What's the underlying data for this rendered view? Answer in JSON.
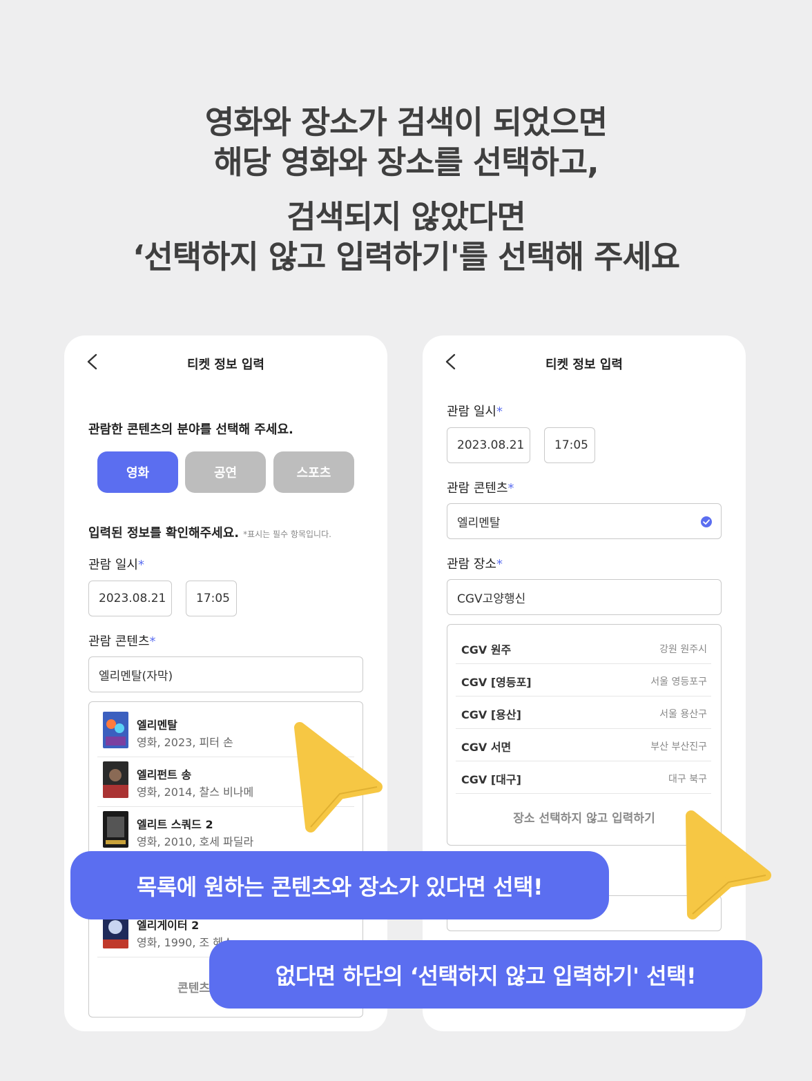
{
  "headline": {
    "line1": "영화와 장소가 검색이 되었으면",
    "line2": "해당 영화와 장소를 선택하고,",
    "line3": "검색되지 않았다면",
    "line4": "‘선택하지 않고 입력하기'를 선택해 주세요"
  },
  "left_screen": {
    "nav_title": "티켓 정보 입력",
    "category_prompt": "관람한 콘텐츠의 분야를 선택해 주세요.",
    "categories": [
      "영화",
      "공연",
      "스포츠"
    ],
    "selected_category": "영화",
    "confirm_title": "입력된 정보를 확인해주세요.",
    "confirm_hint": "*표시는 필수 항목입니다.",
    "date_label": "관람 일시",
    "required_mark": "*",
    "date_value": "2023.08.21",
    "time_value": "17:05",
    "content_label": "관람 콘텐츠",
    "content_value": "엘리멘탈(자막)",
    "movies": [
      {
        "title": "엘리멘탈",
        "sub": "영화, 2023, 피터 손"
      },
      {
        "title": "엘리펀트 송",
        "sub": "영화, 2014, 찰스 비나메"
      },
      {
        "title": "엘리트 스쿼드 2",
        "sub": "영화, 2010, 호세 파딜라"
      },
      {
        "title": "엘리게이터 2",
        "sub": "영화, 1990, 조 헤스"
      }
    ],
    "skip_label": "콘텐츠 선택하"
  },
  "right_screen": {
    "nav_title": "티켓 정보 입력",
    "date_label": "관람 일시",
    "required_mark": "*",
    "date_value": "2023.08.21",
    "time_value": "17:05",
    "content_label": "관람 콘텐츠",
    "content_value": "엘리멘탈",
    "place_label": "관람 장소",
    "place_value": "CGV고양행신",
    "places": [
      {
        "name": "CGV 원주",
        "region": "강원 원주시"
      },
      {
        "name": "CGV [영등포]",
        "region": "서울 영등포구"
      },
      {
        "name": "CGV [용산]",
        "region": "서울 용산구"
      },
      {
        "name": "CGV 서면",
        "region": "부산 부산진구"
      },
      {
        "name": "CGV [대구]",
        "region": "대구 북구"
      }
    ],
    "skip_label": "장소 선택하지 않고 입력하기"
  },
  "callouts": {
    "first": "목록에 원하는 콘텐츠와 장소가 있다면 선택!",
    "second": "없다면 하단의 ‘선택하지 않고 입력하기' 선택!"
  },
  "colors": {
    "accent": "#5b6ef0",
    "cursor": "#f6c744",
    "background": "#eeeeef",
    "inactive": "#bdbdbd"
  },
  "icons": {
    "back": "chevron-left-icon",
    "verified": "check-circle-icon",
    "pointer": "cursor-arrow-icon"
  }
}
